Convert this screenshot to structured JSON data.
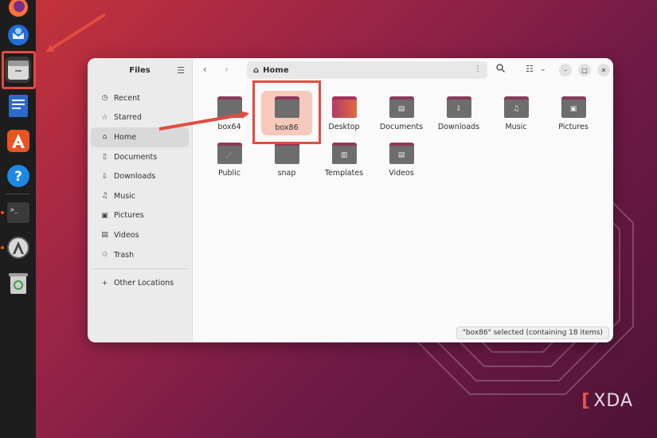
{
  "window": {
    "sidebar_title": "Files",
    "path": "Home"
  },
  "sidebar": {
    "places": [
      {
        "label": "Recent",
        "icon": "clock-icon"
      },
      {
        "label": "Starred",
        "icon": "star-icon"
      },
      {
        "label": "Home",
        "icon": "home-icon",
        "active": true
      },
      {
        "label": "Documents",
        "icon": "document-icon"
      },
      {
        "label": "Downloads",
        "icon": "download-icon"
      },
      {
        "label": "Music",
        "icon": "music-icon"
      },
      {
        "label": "Pictures",
        "icon": "picture-icon"
      },
      {
        "label": "Videos",
        "icon": "video-icon"
      },
      {
        "label": "Trash",
        "icon": "trash-icon"
      }
    ],
    "other": {
      "label": "Other Locations",
      "icon": "plus-icon"
    }
  },
  "folders": [
    {
      "label": "box64",
      "icon": "folder-icon"
    },
    {
      "label": "box86",
      "icon": "folder-icon",
      "selected": true
    },
    {
      "label": "Desktop",
      "icon": "desktop-folder-icon"
    },
    {
      "label": "Documents",
      "icon": "documents-folder-icon"
    },
    {
      "label": "Downloads",
      "icon": "downloads-folder-icon"
    },
    {
      "label": "Music",
      "icon": "music-folder-icon"
    },
    {
      "label": "Pictures",
      "icon": "pictures-folder-icon"
    },
    {
      "label": "Public",
      "icon": "public-folder-icon"
    },
    {
      "label": "snap",
      "icon": "folder-icon"
    },
    {
      "label": "Templates",
      "icon": "templates-folder-icon"
    },
    {
      "label": "Videos",
      "icon": "videos-folder-icon"
    }
  ],
  "status": "\"box86\" selected  (containing 18 items)",
  "dock": [
    {
      "name": "firefox-icon"
    },
    {
      "name": "thunderbird-icon"
    },
    {
      "name": "files-icon"
    },
    {
      "name": "writer-icon"
    },
    {
      "name": "app-center-icon"
    },
    {
      "name": "help-icon"
    },
    {
      "name": "terminal-icon"
    },
    {
      "name": "software-updater-icon"
    },
    {
      "name": "trash-dock-icon"
    }
  ],
  "watermark": "XDA",
  "colors": {
    "accent": "#e95420",
    "annotation_red": "#e24c3f",
    "selection": "#f7c9bd",
    "folder_tab": "#8a3a5c"
  }
}
